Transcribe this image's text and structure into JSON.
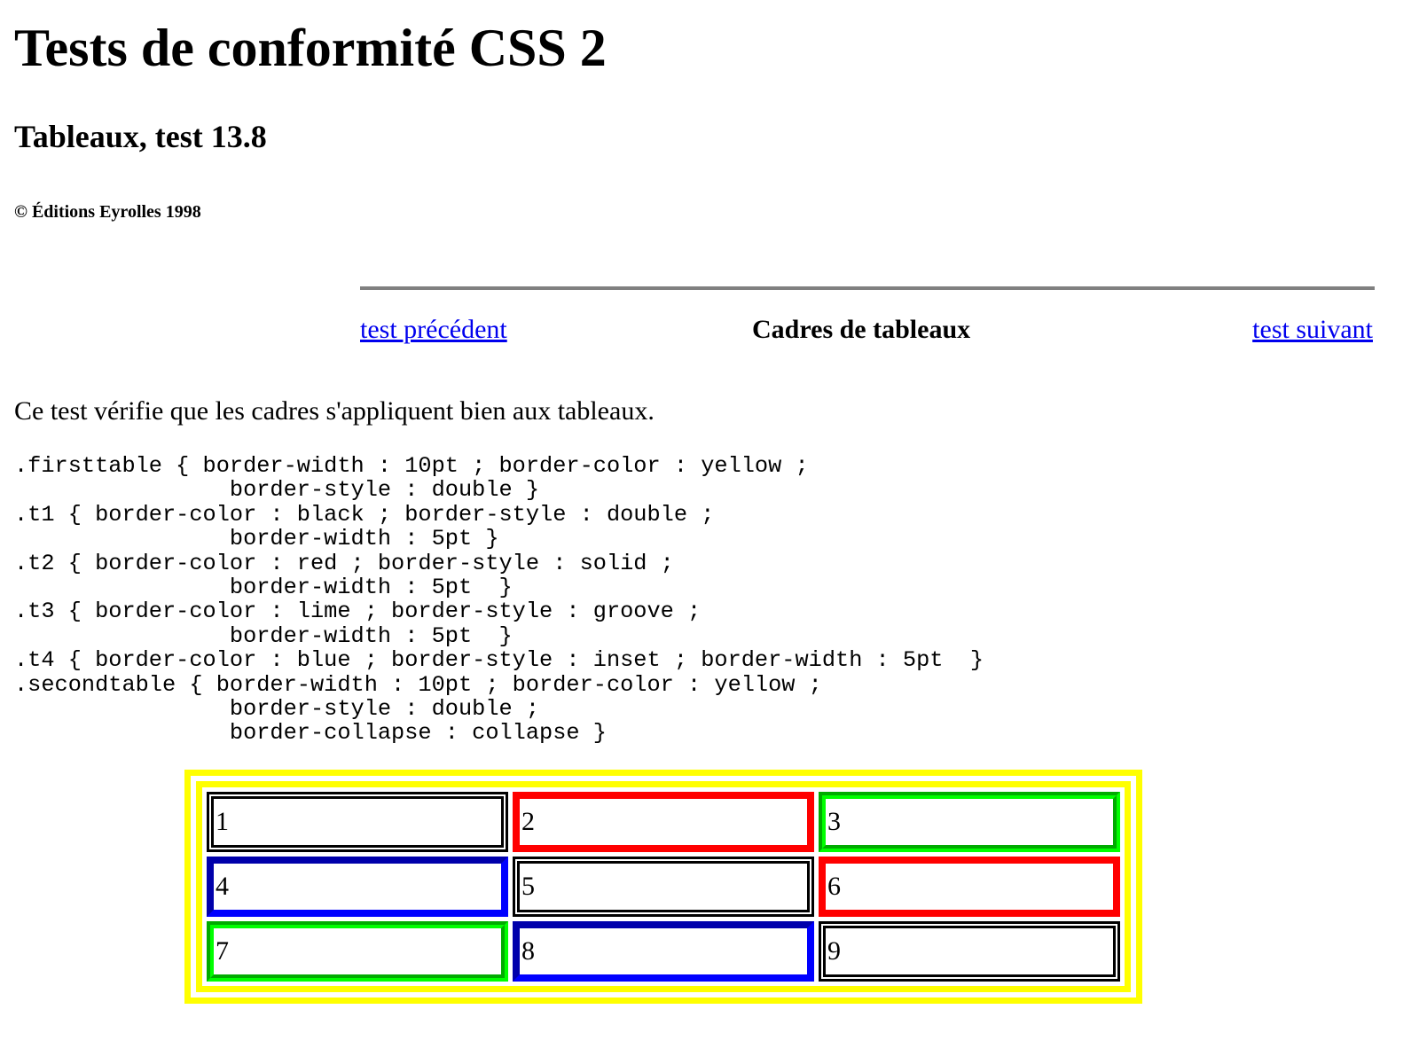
{
  "heading": {
    "title": "Tests de conformité CSS 2",
    "subtitle": "Tableaux, test 13.8",
    "copyright": "© Éditions Eyrolles 1998"
  },
  "nav": {
    "prev_label": "test précédent",
    "section_title": "Cadres de tableaux",
    "next_label": "test suivant"
  },
  "intro": "Ce test vérifie que les cadres s'appliquent bien aux tableaux.",
  "code_lines": [
    ".firsttable { border-width : 10pt ; border-color : yellow ;",
    "                border-style : double }",
    ".t1 { border-color : black ; border-style : double ;",
    "                border-width : 5pt }",
    ".t2 { border-color : red ; border-style : solid ;",
    "                border-width : 5pt  }",
    ".t3 { border-color : lime ; border-style : groove ;",
    "                border-width : 5pt  }",
    ".t4 { border-color : blue ; border-style : inset ; border-width : 5pt  }",
    ".secondtable { border-width : 10pt ; border-color : yellow ;",
    "                border-style : double ;",
    "                border-collapse : collapse }"
  ],
  "table": {
    "rows": [
      [
        {
          "text": "1",
          "class": "t1"
        },
        {
          "text": "2",
          "class": "t2"
        },
        {
          "text": "3",
          "class": "t3"
        }
      ],
      [
        {
          "text": "4",
          "class": "t4"
        },
        {
          "text": "5",
          "class": "t1"
        },
        {
          "text": "6",
          "class": "t2"
        }
      ],
      [
        {
          "text": "7",
          "class": "t3"
        },
        {
          "text": "8",
          "class": "t4"
        },
        {
          "text": "9",
          "class": "t1"
        }
      ]
    ]
  }
}
